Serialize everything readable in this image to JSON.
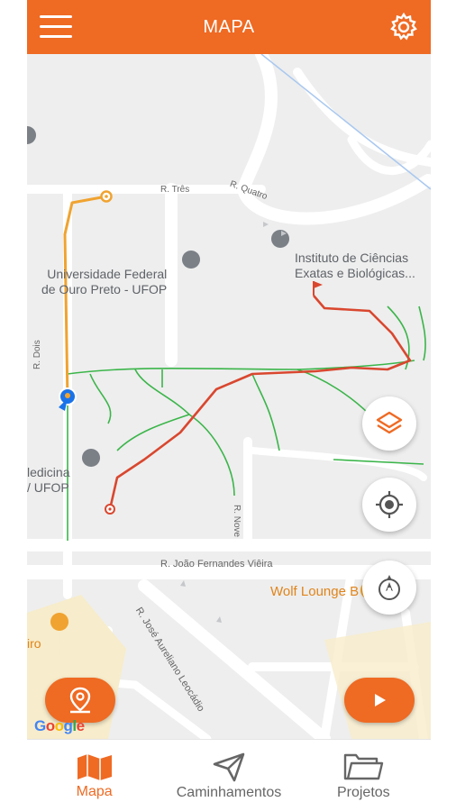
{
  "header": {
    "title": "MAPA",
    "menu_icon": "hamburger-menu-icon",
    "settings_icon": "gear-icon"
  },
  "map": {
    "street_labels": {
      "r_tres": "R. Três",
      "r_quatro": "R. Quatro",
      "r_dois": "R. Dois",
      "r_nove": "R. Nove",
      "r_joao": "R. João Fernandes Viêira",
      "r_jose": "R. José Aureliano Leocádio"
    },
    "poi": {
      "ufop_line1": "Universidade Federal",
      "ufop_line2": "de Ouro Preto - UFOP",
      "iceb_line1": "Instituto de Ciências",
      "iceb_line2": "Exatas e Biológicas...",
      "medicina_line1": "ledicina",
      "medicina_line2": "/ UFOP",
      "wolf": "Wolf Lounge B",
      "iro": "iro"
    },
    "attribution": [
      "G",
      "o",
      "o",
      "g",
      "l",
      "e"
    ],
    "colors": {
      "track_orange": "#f0a330",
      "track_red": "#d9472f",
      "trails_green": "#3bb54a",
      "accent": "#ef6a23"
    }
  },
  "controls": {
    "layers_icon": "layers-icon",
    "locate_icon": "crosshair-location-icon",
    "compass_icon": "compass-icon",
    "location_pin_icon": "location-pin-icon",
    "play_icon": "play-icon"
  },
  "bottom_nav": {
    "items": [
      {
        "label": "Mapa",
        "icon": "map-icon",
        "active": true
      },
      {
        "label": "Caminhamentos",
        "icon": "send-arrow-icon",
        "active": false
      },
      {
        "label": "Projetos",
        "icon": "folder-icon",
        "active": false
      }
    ]
  }
}
